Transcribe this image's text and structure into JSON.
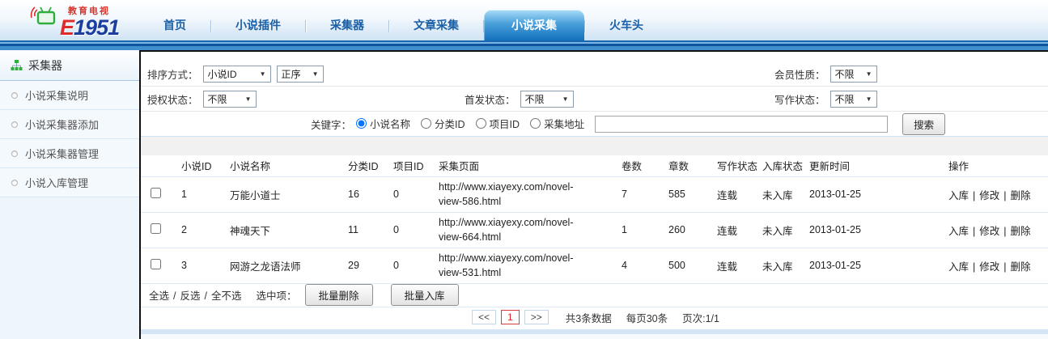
{
  "header": {
    "logo": {
      "brand_top": "教育电视",
      "brand_e": "E",
      "brand_num": "1951"
    },
    "nav": [
      {
        "label": "首页",
        "active": false
      },
      {
        "label": "小说插件",
        "active": false
      },
      {
        "label": "采集器",
        "active": false
      },
      {
        "label": "文章采集",
        "active": false
      },
      {
        "label": "小说采集",
        "active": true
      },
      {
        "label": "火车头",
        "active": false
      }
    ]
  },
  "sidebar": {
    "title": "采集器",
    "items": [
      "小说采集说明",
      "小说采集器添加",
      "小说采集器管理",
      "小说入库管理"
    ]
  },
  "filters": {
    "sort": {
      "label": "排序方式：",
      "field_value": "小说ID",
      "order_value": "正序"
    },
    "member": {
      "label": "会员性质：",
      "value": "不限"
    },
    "auth": {
      "label": "授权状态：",
      "value": "不限"
    },
    "first_publish": {
      "label": "首发状态：",
      "value": "不限"
    },
    "writing": {
      "label": "写作状态：",
      "value": "不限"
    },
    "keyword": {
      "label": "关键字：",
      "options": [
        {
          "label": "小说名称",
          "checked": true
        },
        {
          "label": "分类ID",
          "checked": false
        },
        {
          "label": "项目ID",
          "checked": false
        },
        {
          "label": "采集地址",
          "checked": false
        }
      ],
      "input_value": "",
      "search_label": "搜索"
    }
  },
  "table": {
    "headers": [
      "小说ID",
      "小说名称",
      "分类ID",
      "项目ID",
      "采集页面",
      "卷数",
      "章数",
      "写作状态",
      "入库状态",
      "更新时间",
      "操作"
    ],
    "action_separator": "|",
    "rows": [
      {
        "id": "1",
        "name": "万能小道士",
        "category_id": "16",
        "project_id": "0",
        "url": "http://www.xiayexy.com/novel-view-586.html",
        "volumes": "7",
        "chapters": "585",
        "writing_status": "连载",
        "store_status": "未入库",
        "updated": "2013-01-25",
        "actions": [
          "入库",
          "修改",
          "删除"
        ]
      },
      {
        "id": "2",
        "name": "神魂天下",
        "category_id": "11",
        "project_id": "0",
        "url": "http://www.xiayexy.com/novel-view-664.html",
        "volumes": "1",
        "chapters": "260",
        "writing_status": "连载",
        "store_status": "未入库",
        "updated": "2013-01-25",
        "actions": [
          "入库",
          "修改",
          "删除"
        ]
      },
      {
        "id": "3",
        "name": "网游之龙语法师",
        "category_id": "29",
        "project_id": "0",
        "url": "http://www.xiayexy.com/novel-view-531.html",
        "volumes": "4",
        "chapters": "500",
        "writing_status": "连载",
        "store_status": "未入库",
        "updated": "2013-01-25",
        "actions": [
          "入库",
          "修改",
          "删除"
        ]
      }
    ]
  },
  "footer": {
    "select_links": [
      "全选",
      "反选",
      "全不选"
    ],
    "select_separator": "/",
    "selected_label": "选中项：",
    "batch_delete": "批量删除",
    "batch_store": "批量入库"
  },
  "pagination": {
    "prev": "<<",
    "current": "1",
    "next": ">>",
    "total": "共3条数据",
    "per_page": "每页30条",
    "page_info": "页次:1/1"
  },
  "colors": {
    "accent_blue": "#1371bd",
    "nav_link": "#1b5fa6",
    "brand_red": "#e02b2b",
    "brand_blue": "#1b3f9e",
    "current_page_red": "#dd2222",
    "row_divider": "#dcebf7"
  }
}
